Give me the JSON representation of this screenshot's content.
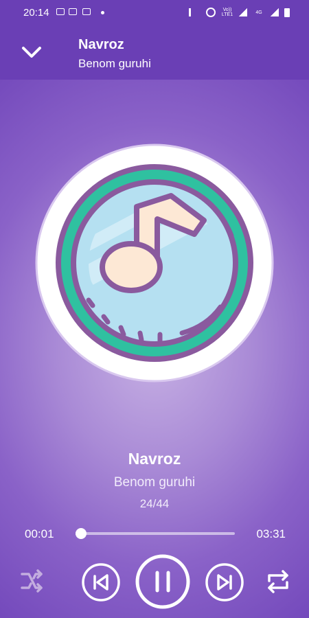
{
  "status_bar": {
    "time": "20:14",
    "signal_1": "Vo)) LTE1",
    "signal_2": "4G"
  },
  "app_bar": {
    "title": "Navroz",
    "subtitle": "Benom guruhi",
    "collapse_icon": "chevron-down-icon"
  },
  "now_playing": {
    "title": "Navroz",
    "artist": "Benom guruhi",
    "track_index": "24/44"
  },
  "playback": {
    "current_time": "00:01",
    "total_time": "03:31",
    "progress": 0.005,
    "is_playing": true
  },
  "controls": [
    "shuffle-icon",
    "previous-icon",
    "pause-icon",
    "next-icon",
    "repeat-icon"
  ],
  "colors": {
    "accent": "#6a3fb5",
    "album_ring": "#2fc1a0",
    "album_outline": "#8a5a9e",
    "note_fill": "#fde8d5"
  }
}
